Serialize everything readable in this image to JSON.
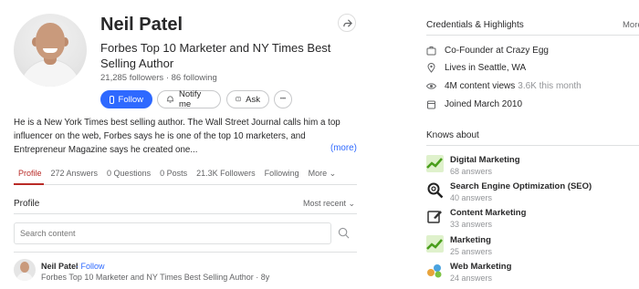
{
  "profile": {
    "name": "Neil Patel",
    "headline": "Forbes Top 10 Marketer and NY Times Best Selling Author",
    "followers_line": "21,285 followers · 86 following",
    "buttons": {
      "follow": "Follow",
      "notify": "Notify me",
      "ask": "Ask",
      "more": "•••"
    },
    "bio": "He is a New York Times best selling author. The Wall Street Journal calls him a top influencer on the web, Forbes says he is one of the top 10 marketers, and Entrepreneur Magazine says he created one...",
    "bio_more": "(more)"
  },
  "tabs": [
    {
      "label": "Profile",
      "active": true
    },
    {
      "label": "272 Answers"
    },
    {
      "label": "0 Questions"
    },
    {
      "label": "0 Posts"
    },
    {
      "label": "21.3K Followers"
    },
    {
      "label": "Following"
    },
    {
      "label": "More ⌄"
    }
  ],
  "feed": {
    "section_label": "Profile",
    "sort_label": "Most recent",
    "search_placeholder": "Search content",
    "item": {
      "name": "Neil Patel",
      "follow": "· Follow",
      "credential": "Forbes Top 10 Marketer and NY Times Best Selling Author · 8y"
    }
  },
  "credentials": {
    "title": "Credentials & Highlights",
    "more": "More",
    "items": [
      {
        "icon": "briefcase-icon",
        "text": "Co-Founder at Crazy Egg",
        "sub": ""
      },
      {
        "icon": "location-pin-icon",
        "text": "Lives in Seattle, WA",
        "sub": ""
      },
      {
        "icon": "eye-icon",
        "text": "4M content views",
        "sub": "3.6K this month"
      },
      {
        "icon": "calendar-icon",
        "text": "Joined March 2010",
        "sub": ""
      }
    ]
  },
  "knows_about": {
    "title": "Knows about",
    "topics": [
      {
        "name": "Digital Marketing",
        "count": "68 answers",
        "color": "#7cc242"
      },
      {
        "name": "Search Engine Optimization (SEO)",
        "count": "40 answers",
        "color": "#222222"
      },
      {
        "name": "Content Marketing",
        "count": "33 answers",
        "color": "#333333"
      },
      {
        "name": "Marketing",
        "count": "25 answers",
        "color": "#7cc242"
      },
      {
        "name": "Web Marketing",
        "count": "24 answers",
        "color": "#e8a33b"
      }
    ]
  },
  "colors": {
    "accent": "#2e69ff",
    "active_tab": "#b92b27"
  }
}
